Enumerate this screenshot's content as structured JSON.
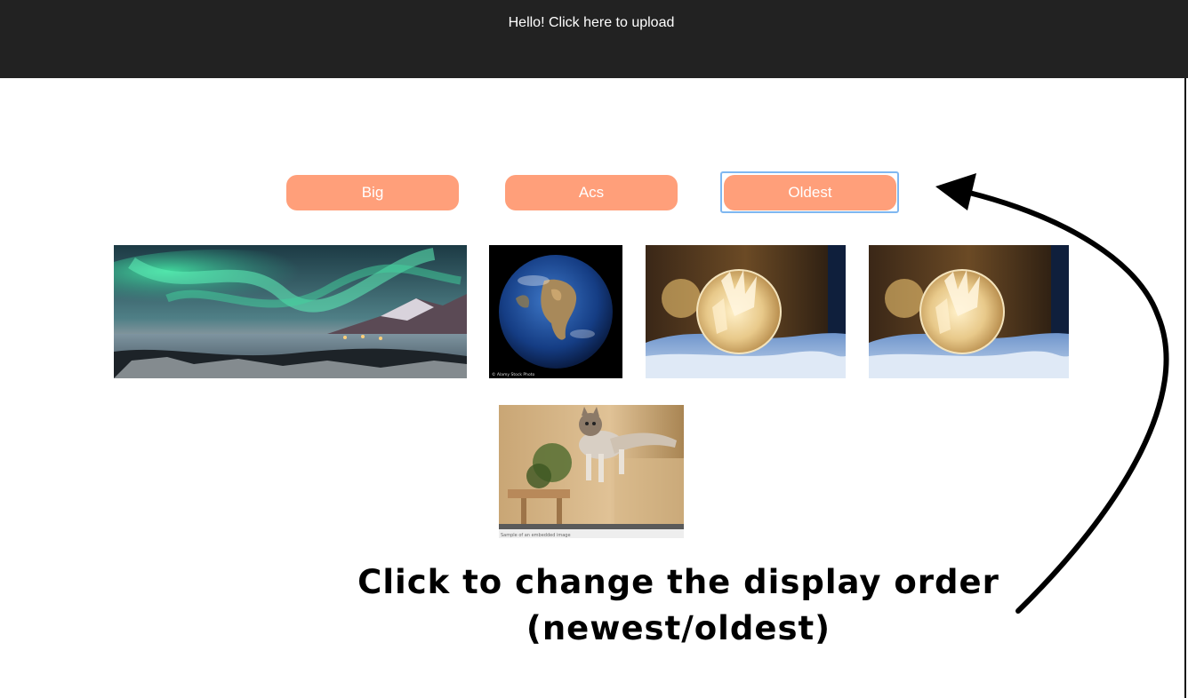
{
  "header": {
    "upload_link": "Hello! Click here to upload",
    "background": "#222222"
  },
  "sort_buttons": [
    {
      "label": "Big"
    },
    {
      "label": "Acs"
    },
    {
      "label": "Oldest",
      "focused": true
    }
  ],
  "colors": {
    "button": "#FF9F7A",
    "focus_ring": "#7FB7F0"
  },
  "gallery": [
    {
      "subject": "aurora-landscape"
    },
    {
      "subject": "earth-globe",
      "caption": "© Alamy Stock Photo"
    },
    {
      "subject": "frozen-bubble"
    },
    {
      "subject": "frozen-bubble"
    },
    {
      "subject": "jumping-kitten",
      "caption": "Sample of an embedded image"
    }
  ],
  "annotation": {
    "line1": "Click to change the display order",
    "line2": "(newest/oldest)"
  },
  "icons": {
    "annotation_arrow": "curved-arrow-icon"
  }
}
